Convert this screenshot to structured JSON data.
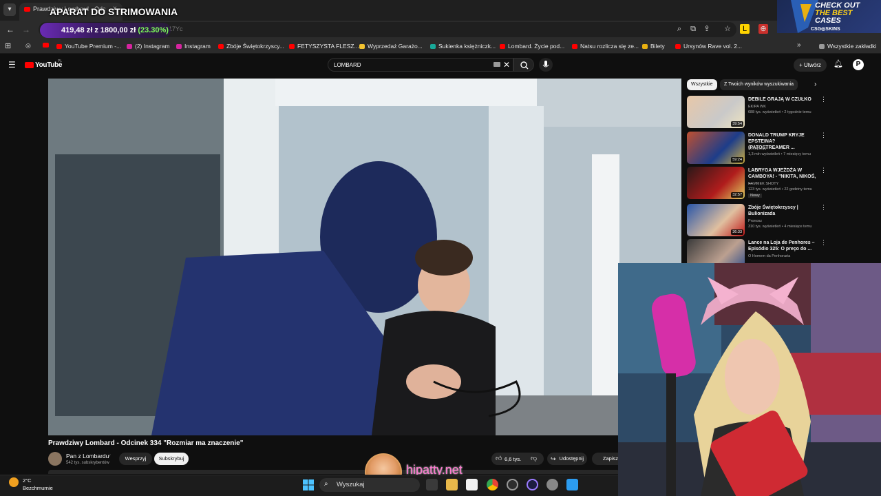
{
  "browser": {
    "tab_title": "Prawdziwy Lombard - Odc",
    "tab_close": "×",
    "overlay_title": "APARAT DO STRIMOWANIA",
    "url_fragment": "BSCN17Yc",
    "goal": {
      "amount": "419,48 zł",
      "separator": "z",
      "target": "1800,00 zł",
      "percent": "(23.30%)"
    },
    "bookmarks": [
      {
        "label": "YouTube Premium -...",
        "color": "#ff0000"
      },
      {
        "label": "(2) Instagram",
        "color": "#d6249f"
      },
      {
        "label": "Instagram",
        "color": "#d6249f"
      },
      {
        "label": "Zbóje Świętokrzyscy...",
        "color": "#ff0000"
      },
      {
        "label": "FETYSZYSTA FLESZ...",
        "color": "#ff0000"
      },
      {
        "label": "Wyprzedaż Garażo...",
        "color": "#f4c430"
      },
      {
        "label": "Sukienka księżniczk...",
        "color": "#18a999"
      },
      {
        "label": "Lombard. Życie pod...",
        "color": "#ff0000"
      },
      {
        "label": "Natsu rozlicza się ze...",
        "color": "#ff0000"
      },
      {
        "label": "Bilety",
        "color": "#e8b010"
      },
      {
        "label": "Ursynów Rave vol. 2...",
        "color": "#ff0000"
      }
    ],
    "all_bookmarks": "Wszystkie zakładki"
  },
  "youtube": {
    "logo": "YouTube",
    "region": "PL",
    "search_query": "LOMBARD",
    "create_label": "+ Utwórz",
    "video": {
      "title": "Prawdziwy Lombard - Odcinek 334 \"Rozmiar ma znaczenie\"",
      "channel": "Pan z Lombardu",
      "subscribers": "542 tys. subskrybentów",
      "support_label": "Wesprzyj",
      "subscribe_label": "Subskrybuj",
      "likes": "6,6 tys.",
      "share_label": "Udostępnij",
      "save_label": "Zapisz"
    },
    "chips": [
      "Wszystkie",
      "Z Twoich wyników wyszukiwania"
    ],
    "recommendations": [
      {
        "title": "DEBILE GRAJĄ W CZUŁKO",
        "channel": "EKIPA WK",
        "meta": "688 tys. wyświetleń • 2 tygodnie temu",
        "duration": "39:54"
      },
      {
        "title": "DONALD TRUMP KRYJE EPSTEINA? (PATOSTREAMER ...",
        "channel": "Konopskyy",
        "meta": "1,3 mln wyświetleń • 7 miesięcy temu",
        "duration": "59:24"
      },
      {
        "title": "LABRYGA WJEŻDŻA W CAMBOYA! - \"NIKITA, NIKOŚ, ...",
        "channel": "KAMMEK SHOTY",
        "meta": "123 tys. wyświetleń • 22 godziny temu",
        "duration": "32:57",
        "badge": "Nowy"
      },
      {
        "title": "Zbóje Świętokrzyscy | Bulionizada",
        "channel": "Pronosz",
        "meta": "310 tys. wyświetleń • 4 miesiące temu",
        "duration": "36:33"
      },
      {
        "title": "Lance na Loja de Penhores – Episódio 325: O preço do ...",
        "channel": "O Homem da Penhoraria",
        "meta": "",
        "duration": ""
      }
    ]
  },
  "taskbar": {
    "temperature": "2°C",
    "weather": "Bezchmurnie",
    "search_label": "Wyszukaj"
  },
  "ad": {
    "line1": "CHECK OUT",
    "line2": "THE BEST",
    "line3": "CASES",
    "brand": "CSG◎SKINS"
  },
  "watermark": "hipatty.net"
}
